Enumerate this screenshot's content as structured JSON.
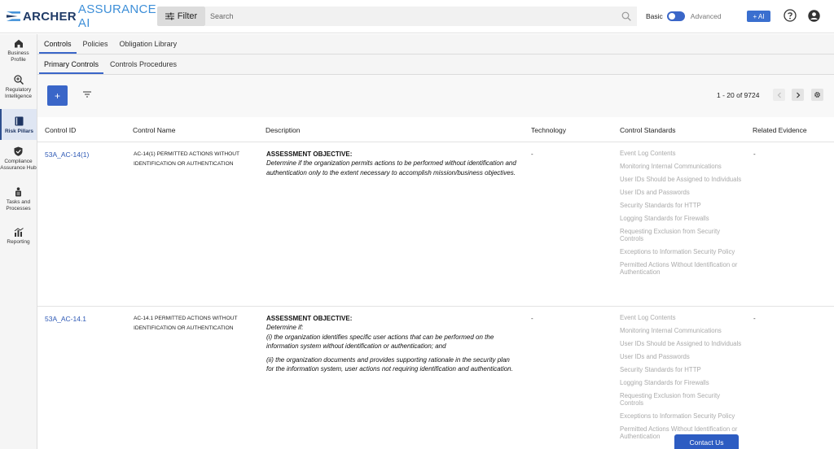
{
  "brand": {
    "name_bold": "ARCHER",
    "name_light": "ASSURANCE AI"
  },
  "topbar": {
    "filter_label": "Filter",
    "search_placeholder": "Search",
    "mode_basic": "Basic",
    "mode_advanced": "Advanced",
    "ai_label": "+ AI"
  },
  "sidebar": {
    "items": [
      {
        "label": "Business Profile",
        "icon": "home-icon"
      },
      {
        "label": "Regulatory Intelligence",
        "icon": "magnify-plus-icon"
      },
      {
        "label": "Risk Pillars",
        "icon": "book-icon",
        "active": true
      },
      {
        "label": "Compliance Assurance Hub",
        "icon": "shield-check-icon"
      },
      {
        "label": "Tasks and Processes",
        "icon": "tasks-icon"
      },
      {
        "label": "Reporting",
        "icon": "chart-icon"
      }
    ]
  },
  "tabs_primary": [
    "Controls",
    "Policies",
    "Obligation Library"
  ],
  "tabs_secondary": [
    "Primary Controls",
    "Controls Procedures"
  ],
  "toolbar": {
    "add_label": "+",
    "pager": "1 - 20 of 9724"
  },
  "table": {
    "headers": [
      "Control ID",
      "Control Name",
      "Description",
      "Technology",
      "Control Standards",
      "Related Evidence"
    ],
    "rows": [
      {
        "id": "53A_AC-14(1)",
        "name": "AC-14(1) PERMITTED ACTIONS WITHOUT IDENTIFICATION OR AUTHENTICATION",
        "desc_title": "ASSESSMENT OBJECTIVE:",
        "desc_lines": [
          "Determine if the organization permits actions to be performed without identification and authentication only to the extent necessary to accomplish mission/business objectives."
        ],
        "technology": "-",
        "standards": [
          "Event Log Contents",
          "Monitoring Internal Communications",
          "User IDs Should be Assigned to Individuals",
          "User IDs and Passwords",
          "Security Standards for HTTP",
          "Logging Standards for Firewalls",
          "Requesting Exclusion from Security Controls",
          "Exceptions to Information Security Policy",
          "Permitted Actions Without Identification or Authentication"
        ],
        "evidence": "-"
      },
      {
        "id": "53A_AC-14.1",
        "name": "AC-14.1 PERMITTED ACTIONS WITHOUT IDENTIFICATION OR AUTHENTICATION",
        "desc_title": "ASSESSMENT OBJECTIVE:",
        "desc_lines": [
          "Determine if:",
          "(i) the organization identifies specific user actions that can be performed on the information system without identification or authentication; and",
          "(ii) the organization documents and provides supporting rationale in the security plan for the information system, user actions not requiring identification and authentication."
        ],
        "technology": "-",
        "standards": [
          "Event Log Contents",
          "Monitoring Internal Communications",
          "User IDs Should be Assigned to Individuals",
          "User IDs and Passwords",
          "Security Standards for HTTP",
          "Logging Standards for Firewalls",
          "Requesting Exclusion from Security Controls",
          "Exceptions to Information Security Policy",
          "Permitted Actions Without Identification or Authentication"
        ],
        "evidence": "-"
      }
    ]
  },
  "contact_label": "Contact Us"
}
